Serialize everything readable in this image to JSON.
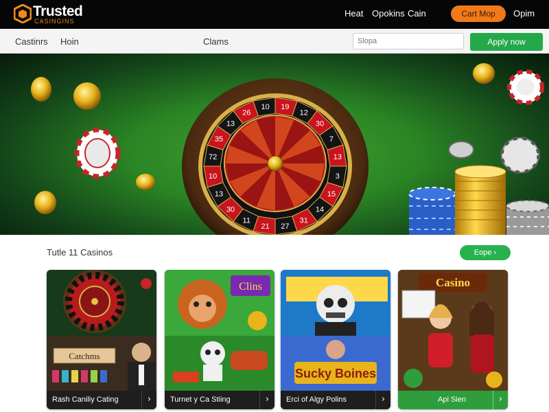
{
  "brand": {
    "name": "Trusted",
    "tagline": "CASINGINS"
  },
  "topnav": {
    "items": [
      "Heat",
      "Opokins",
      "Cain"
    ],
    "cta_label": "Cart Mop",
    "right_link": "Opim"
  },
  "subnav": {
    "items": [
      "Castinrs",
      "Hoin",
      "Clams"
    ],
    "search_placeholder": "Slopa",
    "apply_label": "Apply now"
  },
  "hero": {
    "wheel_numbers": [
      "19",
      "12",
      "30",
      "7",
      "13",
      "3",
      "15",
      "14",
      "31",
      "27",
      "21",
      "11",
      "30",
      "13",
      "10",
      "72",
      "35",
      "13",
      "26",
      "10"
    ]
  },
  "section": {
    "title": "Tutle 11 Casinos",
    "see_all_label": "Eope"
  },
  "cards": [
    {
      "label": "Rash Caniliy Cating",
      "badge": "Catchms",
      "arrow": "›"
    },
    {
      "label": "Turnet y Ca Stiing",
      "badge": "Clins",
      "arrow": "›"
    },
    {
      "label": "Erci of Algy Polins",
      "badge": "Sucky Boines",
      "arrow": "›"
    },
    {
      "label": "Api Sien",
      "badge": "Casino",
      "arrow": "›"
    }
  ],
  "colors": {
    "topbar": "#060606",
    "accent_orange": "#f07a1a",
    "accent_green": "#24a94a",
    "hero_green": "#2a8424"
  },
  "icons": [
    "logo-icon",
    "chevron-right-icon",
    "chevron-right-icon",
    "chevron-right-icon",
    "chevron-right-icon"
  ]
}
